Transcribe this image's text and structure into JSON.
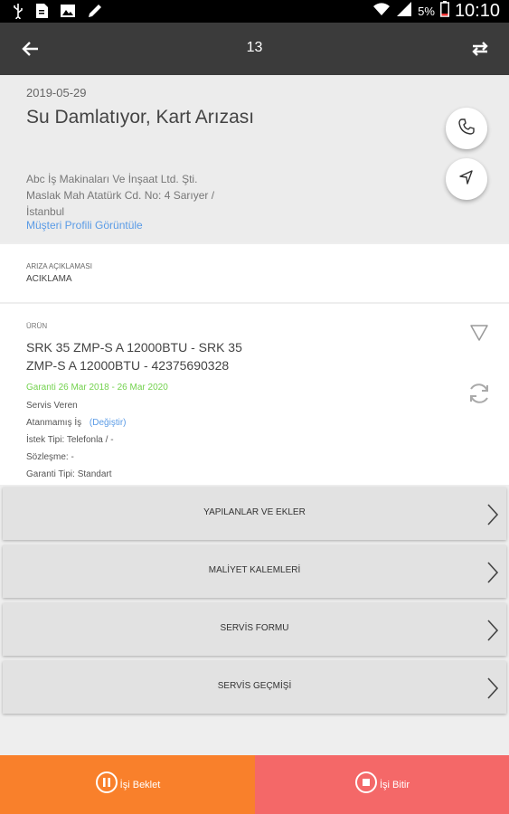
{
  "status_bar": {
    "battery_percent": "5%",
    "time": "10:10",
    "icons": [
      "usb-icon",
      "sd-card-icon",
      "image-icon",
      "pencil-icon",
      "wifi-icon",
      "signal-icon",
      "battery-icon"
    ]
  },
  "toolbar": {
    "title": "13",
    "icons": [
      "back-arrow-icon",
      "swap-icon"
    ]
  },
  "header": {
    "date": "2019-05-29",
    "title": "Su Damlatıyor, Kart Arızası",
    "company": "Abc İş Makinaları Ve İnşaat Ltd. Şti.",
    "address": "Maslak Mah Atatürk Cd. No: 4 Sarıyer / İstanbul",
    "profile_link": "Müşteri Profili Görüntüle",
    "actions": [
      "phone-icon",
      "navigation-icon"
    ]
  },
  "description": {
    "label": "ARIZA AÇIKLAMASI",
    "value": "ACIKLAMA"
  },
  "product": {
    "label": "ÜRÜN",
    "name": "SRK 35 ZMP-S A 12000BTU - SRK 35 ZMP-S A 12000BTU - 42375690328",
    "warranty": "Garanti 26 Mar 2018 - 26 Mar 2020",
    "service_provider": "Servis Veren",
    "unassigned": "Atanmamış İş",
    "change_link": "(Değiştir)",
    "request_type": "İstek Tipi: Telefonla / -",
    "contract": "Sözleşme: -",
    "warranty_type": "Garanti Tipi: Standart"
  },
  "sections": [
    {
      "label": "YAPILANLAR VE EKLER"
    },
    {
      "label": "MALİYET KALEMLERİ"
    },
    {
      "label": "SERVİS FORMU"
    },
    {
      "label": "SERVİS GEÇMİŞİ"
    }
  ],
  "bottom_bar": {
    "hold_label": "İşi Beklet",
    "finish_label": "İşi Bitir",
    "hold_color": "#f9802b",
    "finish_color": "#f46868"
  },
  "colors": {
    "toolbar": "#3b3b3b",
    "link": "#5a9be6",
    "warranty": "#73d24e"
  }
}
